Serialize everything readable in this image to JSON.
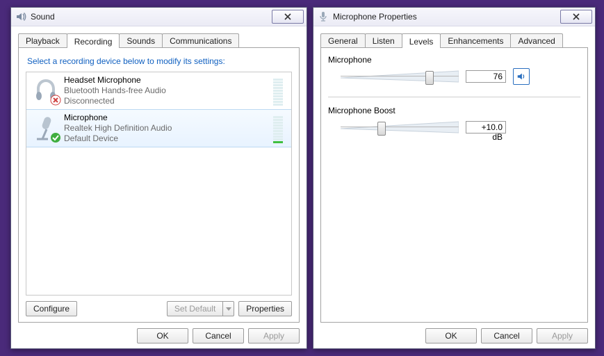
{
  "sound": {
    "title": "Sound",
    "tabs": [
      "Playback",
      "Recording",
      "Sounds",
      "Communications"
    ],
    "active_tab": 1,
    "instruction": "Select a recording device below to modify its settings:",
    "devices": [
      {
        "name": "Headset Microphone",
        "desc": "Bluetooth Hands-free Audio",
        "status": "Disconnected",
        "selected": false,
        "default": false,
        "badge": "disconnected",
        "meter_bars": 0,
        "meter_total": 10
      },
      {
        "name": "Microphone",
        "desc": "Realtek High Definition Audio",
        "status": "Default Device",
        "selected": true,
        "default": true,
        "badge": "default",
        "meter_bars": 1,
        "meter_total": 10
      }
    ],
    "buttons": {
      "configure": "Configure",
      "set_default": "Set Default",
      "properties": "Properties",
      "ok": "OK",
      "cancel": "Cancel",
      "apply": "Apply"
    }
  },
  "mic": {
    "title": "Microphone Properties",
    "tabs": [
      "General",
      "Listen",
      "Levels",
      "Enhancements",
      "Advanced"
    ],
    "active_tab": 2,
    "level": {
      "label": "Microphone",
      "value": "76",
      "pct": 76
    },
    "boost": {
      "label": "Microphone Boost",
      "value": "+10.0 dB",
      "pct": 33
    },
    "buttons": {
      "ok": "OK",
      "cancel": "Cancel",
      "apply": "Apply"
    }
  }
}
